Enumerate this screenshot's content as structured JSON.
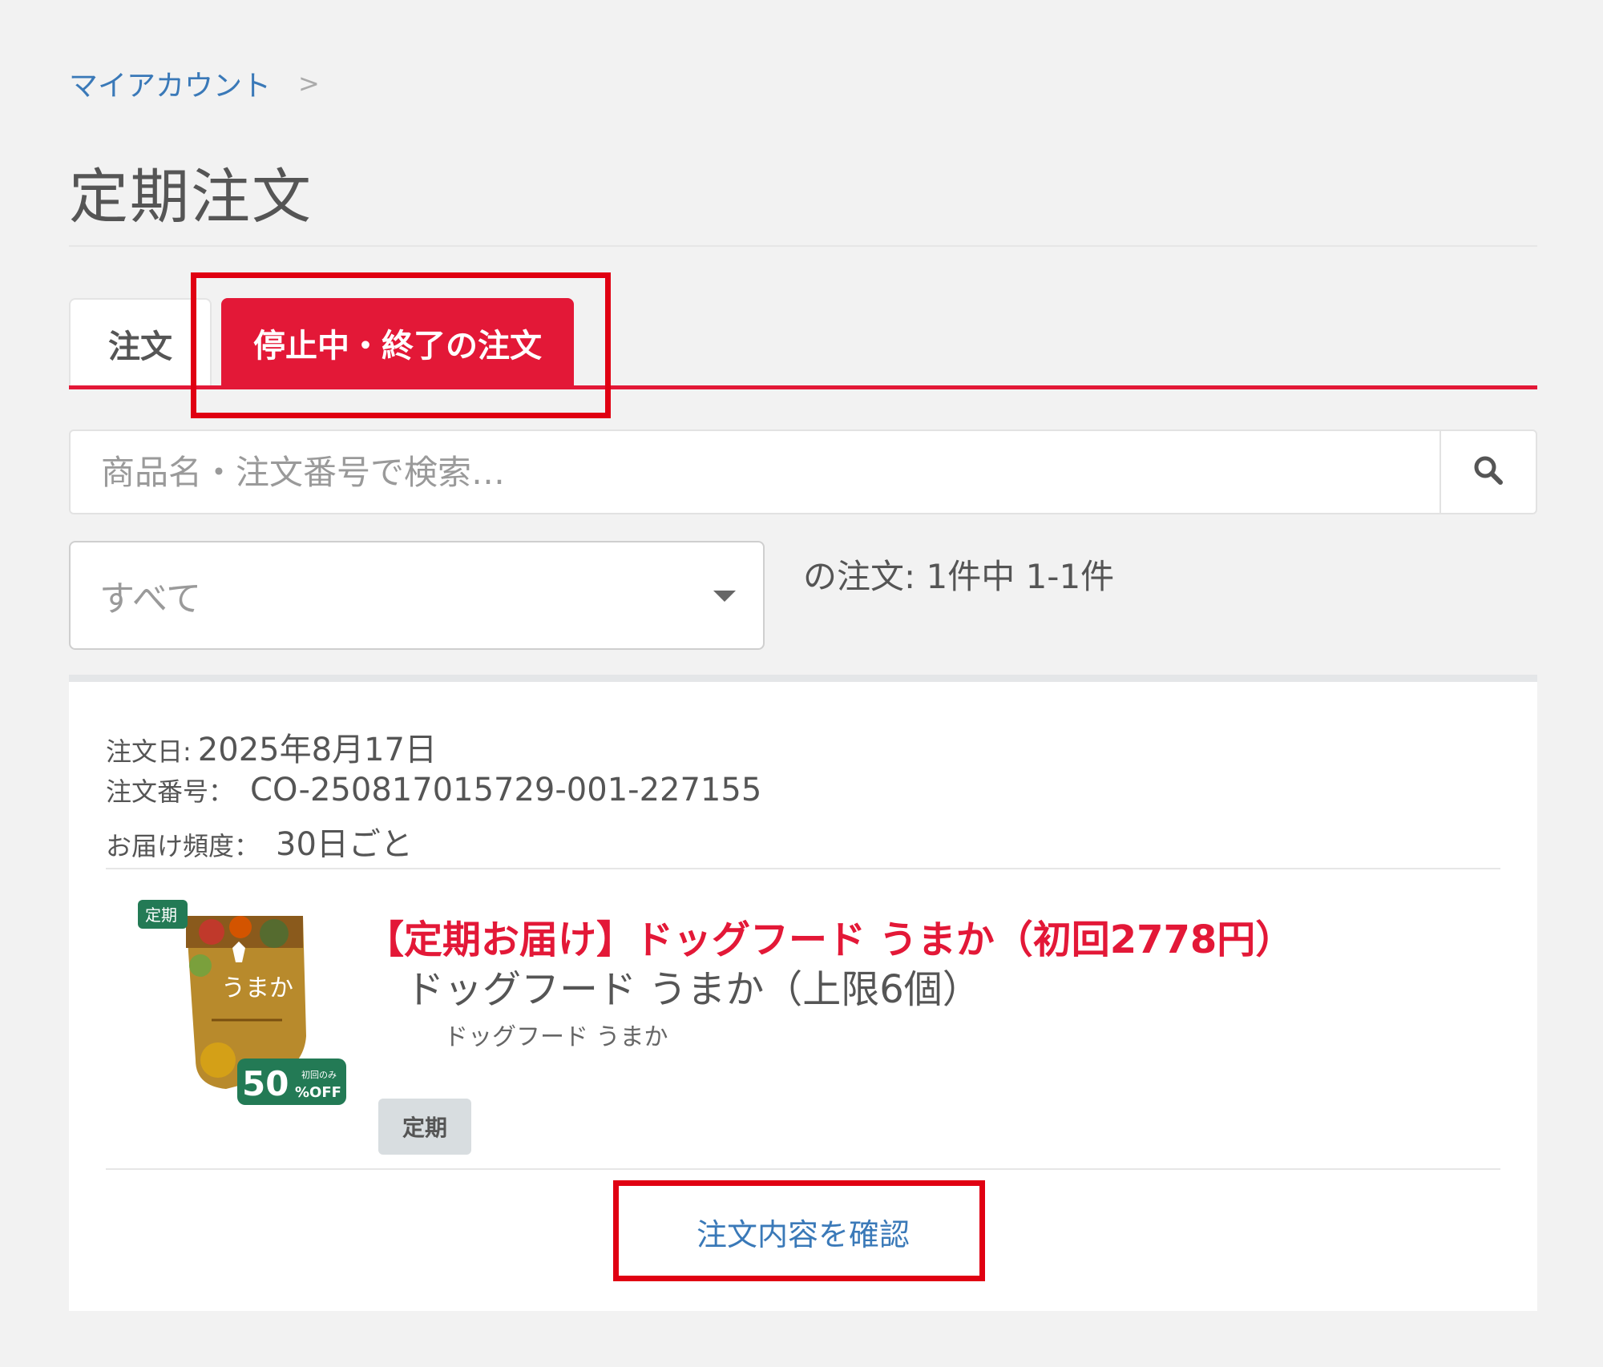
{
  "breadcrumb": {
    "link": "マイアカウント",
    "separator": ">"
  },
  "page_title": "定期注文",
  "tabs": [
    {
      "label": "注文",
      "active": false
    },
    {
      "label": "停止中・終了の注文",
      "active": true
    }
  ],
  "search": {
    "placeholder": "商品名・注文番号で検索…",
    "value": ""
  },
  "filter": {
    "selected": "すべて"
  },
  "result_count": "の注文: 1件中 1-1件",
  "order": {
    "date_label": "注文日:",
    "date_value": "2025年8月17日",
    "number_label": "注文番号：",
    "number_value": "CO-250817015729-001-227155",
    "frequency_label": "お届け頻度：",
    "frequency_value": "30日ごと",
    "product": {
      "name": "【定期お届け】ドッグフード うまか（初回2778円）",
      "variant": "ドッグフード うまか（上限6個）",
      "variant_sub": "ドッグフード うまか",
      "badge": "定期",
      "image": {
        "tag": "定期",
        "package_text": "うまか",
        "discount": "50",
        "discount_unit": "%OFF",
        "discount_note": "初回のみ"
      }
    },
    "view_button": "注文内容を確認"
  },
  "colors": {
    "accent": "#e31837",
    "link": "#3a79b8",
    "annotation": "#e00012",
    "background": "#f2f2f2"
  },
  "icons": {
    "search": "search-icon",
    "dropdown": "chevron-down-icon"
  }
}
